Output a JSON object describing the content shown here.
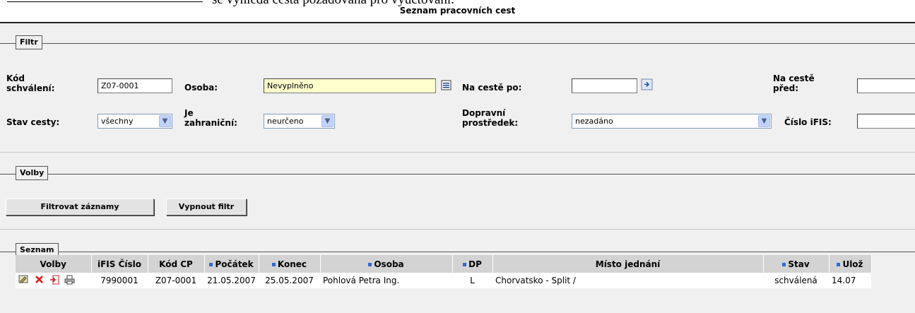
{
  "top_fragment": "se vyhledá cesta požadovaná pro vyúčtování.",
  "page_title": "Seznam pracovních cest",
  "filter": {
    "legend": "Filtr",
    "kod_schvaleni_label": "Kód schválení:",
    "kod_schvaleni_value": "Z07-0001",
    "osoba_label": "Osoba:",
    "osoba_value": "Nevyplněno",
    "na_ceste_po_label": "Na cestě po:",
    "na_ceste_po_value": "",
    "na_ceste_pred_label": "Na cestě před:",
    "na_ceste_pred_value": "",
    "stav_cesty_label": "Stav cesty:",
    "stav_cesty_value": "všechny",
    "je_zahranicni_label": "Je zahraniční:",
    "je_zahranicni_value": "neurčeno",
    "dopravni_prostredek_label": "Dopravní prostředek:",
    "dopravni_prostredek_value": "nezadáno",
    "cislo_ifis_label": "Číslo iFIS:",
    "cislo_ifis_value": ""
  },
  "volby": {
    "legend": "Volby",
    "filter_button": "Filtrovat záznamy",
    "disable_filter_button": "Vypnout filtr"
  },
  "seznam": {
    "legend": "Seznam",
    "columns": [
      "Volby",
      "iFIS Číslo",
      "Kód CP",
      "Počátek",
      "Konec",
      "Osoba",
      "DP",
      "Místo jednání",
      "Stav",
      "Ulož"
    ],
    "rows": [
      {
        "ifis": "7990001",
        "kod_cp": "Z07-0001",
        "pocatek": "21.05.2007",
        "konec": "25.05.2007",
        "osoba": "Pohlová Petra Ing.",
        "dp": "L",
        "misto": "Chorvatsko - Split /",
        "stav": "schválená",
        "uloz": "14.07"
      }
    ]
  },
  "colors": {
    "frame_bg": "#f0f0f0",
    "header_bg": "#d3d3d3",
    "sort_marker": "#2d69d9",
    "highlight_input": "#ffffcc"
  }
}
